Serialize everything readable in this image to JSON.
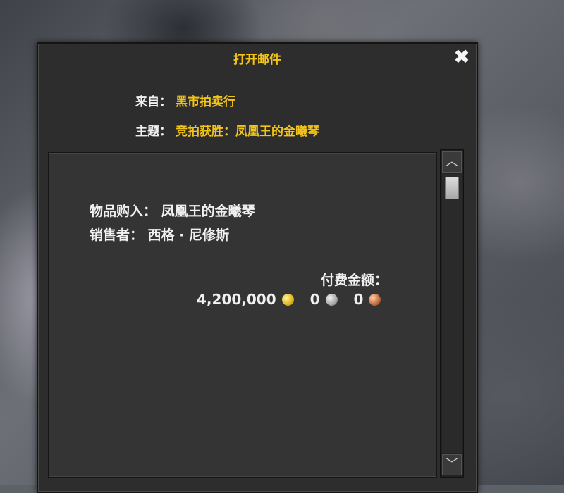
{
  "window": {
    "title": "打开邮件",
    "close_glyph": "✖"
  },
  "header": {
    "from_label": "来自：",
    "from_value": "黑市拍卖行",
    "subject_label": "主题：",
    "subject_value": "竞拍获胜：凤凰王的金曦琴"
  },
  "body": {
    "item_line": "物品购入： 凤凰王的金曦琴",
    "seller_line": "销售者： 西格 · 尼修斯",
    "payment_label": "付费金额：",
    "gold": "4,200,000",
    "silver": "0",
    "copper": "0"
  },
  "scrollbar": {
    "up_glyph": "︿",
    "down_glyph": "﹀"
  },
  "colors": {
    "accent": "#f2c418",
    "panel": "#2d2d2d",
    "text": "#f0f0f0"
  }
}
